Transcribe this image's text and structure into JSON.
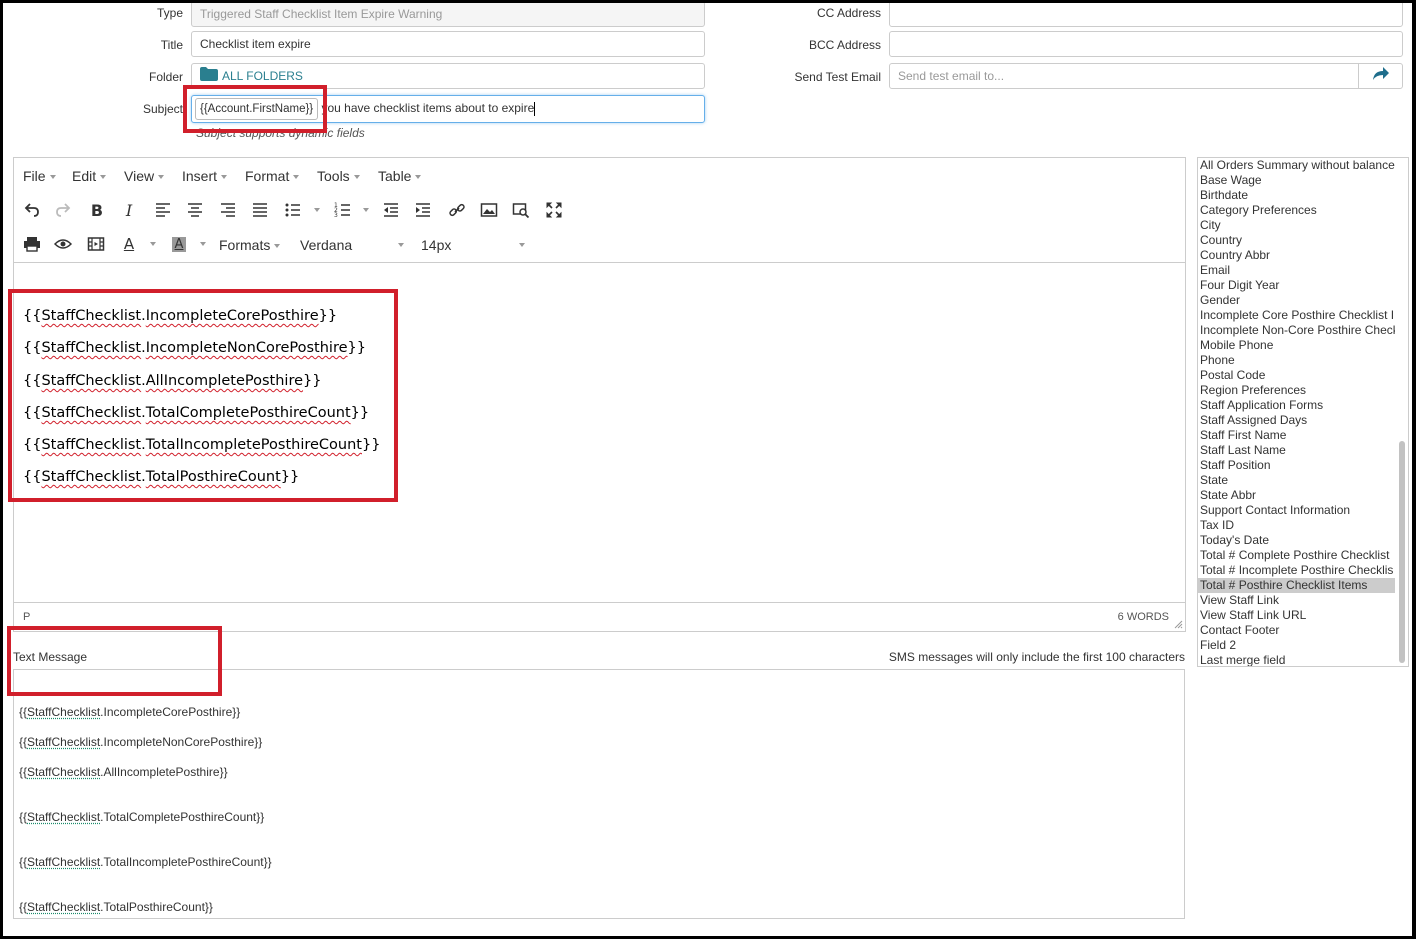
{
  "form": {
    "type_label": "Type",
    "type_value": "Triggered Staff Checklist Item Expire Warning",
    "title_label": "Title",
    "title_value": "Checklist item expire",
    "folder_label": "Folder",
    "folder_value": "ALL FOLDERS",
    "subject_label": "Subject",
    "subject_token": "{{Account.FirstName}}",
    "subject_rest": " you have checklist items about to expire",
    "subject_hint": "Subject supports dynamic fields",
    "cc_label": "CC Address",
    "bcc_label": "BCC Address",
    "test_email_label": "Send Test Email",
    "test_email_placeholder": "Send test email to..."
  },
  "editor": {
    "menus": [
      "File",
      "Edit",
      "View",
      "Insert",
      "Format",
      "Tools",
      "Table"
    ],
    "formats_label": "Formats",
    "font_family": "Verdana",
    "font_size": "14px",
    "content_lines": [
      {
        "prefix": "{{",
        "word": "StaffChecklist",
        "dot": ".",
        "field": "IncompleteCorePosthire",
        "suffix": "}}"
      },
      {
        "prefix": "{{",
        "word": "StaffChecklist",
        "dot": ".",
        "field": "IncompleteNonCorePosthire",
        "suffix": "}}"
      },
      {
        "prefix": "{{",
        "word": "StaffChecklist",
        "dot": ".",
        "field": "AllIncompletePosthire",
        "suffix": "}}"
      },
      {
        "prefix": "{{",
        "word": "StaffChecklist",
        "dot": ".",
        "field": "TotalCompletePosthireCount",
        "suffix": "}}"
      },
      {
        "prefix": "{{",
        "word": "StaffChecklist",
        "dot": ".",
        "field": "TotalIncompletePosthireCount",
        "suffix": "}}"
      },
      {
        "prefix": "{{",
        "word": "StaffChecklist",
        "dot": ".",
        "field": "TotalPosthireCount",
        "suffix": "}}"
      }
    ],
    "status_path": "P",
    "word_count": "6 WORDS"
  },
  "sms": {
    "label": "Text Message",
    "note": "SMS messages will only include the first 100 characters",
    "lines": [
      {
        "prefix": "{{",
        "word": "StaffChecklist",
        "rest": ".IncompleteCorePosthire}}"
      },
      {
        "prefix": "{{",
        "word": "StaffChecklist",
        "rest": ".IncompleteNonCorePosthire}}"
      },
      {
        "prefix": "{{",
        "word": "StaffChecklist",
        "rest": ".AllIncompletePosthire}}"
      },
      {
        "prefix": "{{",
        "word": "StaffChecklist",
        "rest": ".TotalCompletePosthireCount}}"
      },
      {
        "prefix": "{{",
        "word": "StaffChecklist",
        "rest": ".TotalIncompletePosthireCount}}"
      },
      {
        "prefix": "{{",
        "word": "StaffChecklist",
        "rest": ".TotalPosthireCount}}"
      }
    ]
  },
  "merge_fields": {
    "items": [
      "All Orders Summary without balance",
      "Base Wage",
      "Birthdate",
      "Category Preferences",
      "City",
      "Country",
      "Country Abbr",
      "Email",
      "Four Digit Year",
      "Gender",
      "Incomplete Core Posthire Checklist I",
      "Incomplete Non-Core Posthire Check",
      "Mobile Phone",
      "Phone",
      "Postal Code",
      "Region Preferences",
      "Staff Application Forms",
      "Staff Assigned Days",
      "Staff First Name",
      "Staff Last Name",
      "Staff Position",
      "State",
      "State Abbr",
      "Support Contact Information",
      "Tax ID",
      "Today's Date",
      "Total # Complete Posthire Checklist",
      "Total # Incomplete Posthire Checklis",
      "Total # Posthire Checklist Items",
      "View Staff Link",
      "View Staff Link URL",
      "Contact Footer",
      "Field 2",
      "Last merge field"
    ],
    "selected": "Total # Posthire Checklist Items"
  },
  "colors": {
    "highlight_box": "#d11f2b",
    "folder_accent": "#2a7f8f",
    "send_button": "#1f6e8c"
  }
}
